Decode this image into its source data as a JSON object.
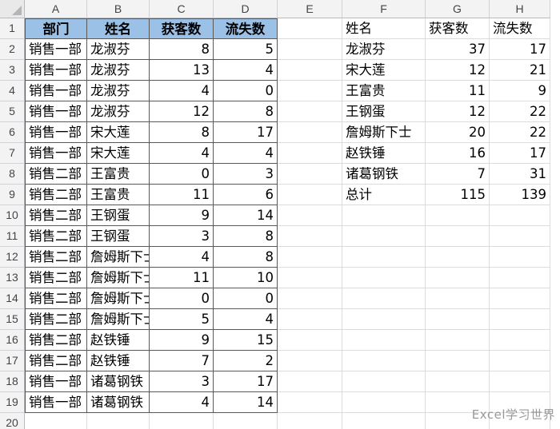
{
  "columns": [
    "A",
    "B",
    "C",
    "D",
    "E",
    "F",
    "G",
    "H"
  ],
  "rows": [
    "1",
    "2",
    "3",
    "4",
    "5",
    "6",
    "7",
    "8",
    "9",
    "10",
    "11",
    "12",
    "13",
    "14",
    "15",
    "16",
    "17",
    "18",
    "19",
    "20"
  ],
  "table1": {
    "headers": [
      "部门",
      "姓名",
      "获客数",
      "流失数"
    ],
    "rows": [
      [
        "销售一部",
        "龙淑芬",
        "8",
        "5"
      ],
      [
        "销售一部",
        "龙淑芬",
        "13",
        "4"
      ],
      [
        "销售一部",
        "龙淑芬",
        "4",
        "0"
      ],
      [
        "销售一部",
        "龙淑芬",
        "12",
        "8"
      ],
      [
        "销售一部",
        "宋大莲",
        "8",
        "17"
      ],
      [
        "销售一部",
        "宋大莲",
        "4",
        "4"
      ],
      [
        "销售二部",
        "王富贵",
        "0",
        "3"
      ],
      [
        "销售二部",
        "王富贵",
        "11",
        "6"
      ],
      [
        "销售二部",
        "王钢蛋",
        "9",
        "14"
      ],
      [
        "销售二部",
        "王钢蛋",
        "3",
        "8"
      ],
      [
        "销售二部",
        "詹姆斯下士",
        "4",
        "8"
      ],
      [
        "销售二部",
        "詹姆斯下士",
        "11",
        "10"
      ],
      [
        "销售二部",
        "詹姆斯下士",
        "0",
        "0"
      ],
      [
        "销售二部",
        "詹姆斯下士",
        "5",
        "4"
      ],
      [
        "销售二部",
        "赵铁锤",
        "9",
        "15"
      ],
      [
        "销售二部",
        "赵铁锤",
        "7",
        "2"
      ],
      [
        "销售一部",
        "诸葛钢铁",
        "3",
        "17"
      ],
      [
        "销售一部",
        "诸葛钢铁",
        "4",
        "14"
      ]
    ]
  },
  "table2": {
    "headers": [
      "姓名",
      "获客数",
      "流失数"
    ],
    "rows": [
      [
        "龙淑芬",
        "37",
        "17"
      ],
      [
        "宋大莲",
        "12",
        "21"
      ],
      [
        "王富贵",
        "11",
        "9"
      ],
      [
        "王钢蛋",
        "12",
        "22"
      ],
      [
        "詹姆斯下士",
        "20",
        "22"
      ],
      [
        "赵铁锤",
        "16",
        "17"
      ],
      [
        "诸葛钢铁",
        "7",
        "31"
      ],
      [
        "总计",
        "115",
        "139"
      ]
    ]
  },
  "watermark": "Excel学习世界",
  "colors": {
    "header_fill": "#9bc2e6",
    "grid": "#dadcdf",
    "table_border": "#595959"
  }
}
